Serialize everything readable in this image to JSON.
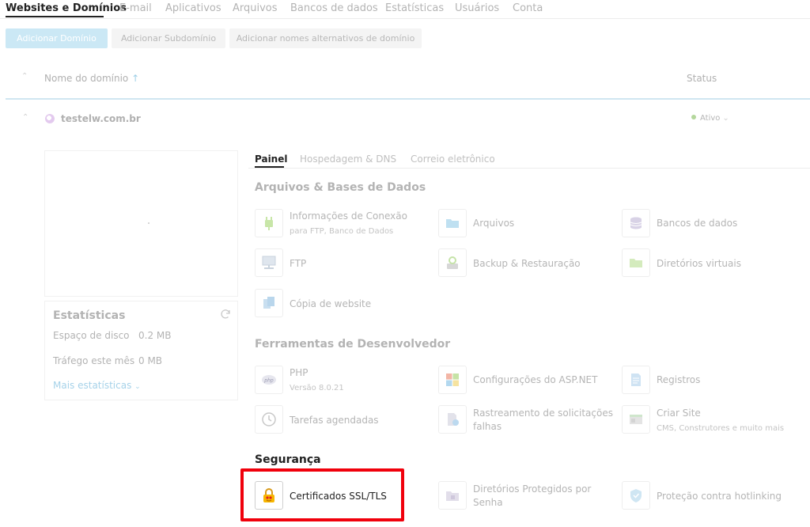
{
  "nav": {
    "tabs": [
      "Websites e Domínios",
      "E-mail",
      "Aplicativos",
      "Arquivos",
      "Bancos de dados",
      "Estatísticas",
      "Usuários",
      "Conta"
    ]
  },
  "toolbar": {
    "add_domain": "Adicionar Domínio",
    "add_subdomain": "Adicionar Subdomínio",
    "add_alias": "Adicionar nomes alternativos de domínio"
  },
  "list_header": {
    "name": "Nome do domínio",
    "sort_arrow": "↑",
    "status": "Status"
  },
  "domain": {
    "name": "testelw.com.br",
    "status": "Ativo"
  },
  "stats": {
    "title": "Estatísticas",
    "disk_label": "Espaço de disco",
    "disk_value": "0.2 MB",
    "traffic_label": "Tráfego este mês",
    "traffic_value": "0 MB",
    "more": "Mais estatísticas"
  },
  "panel_tabs": [
    "Painel",
    "Hospedagem & DNS",
    "Correio eletrônico"
  ],
  "sections": {
    "files_db": {
      "title": "Arquivos & Bases de Dados",
      "items": {
        "connection_info": {
          "title": "Informações de Conexão",
          "sub": "para FTP, Banco de Dados"
        },
        "files": {
          "title": "Arquivos"
        },
        "databases": {
          "title": "Bancos de dados"
        },
        "ftp": {
          "title": "FTP"
        },
        "backup": {
          "title": "Backup & Restauração"
        },
        "virtual_dirs": {
          "title": "Diretórios virtuais"
        },
        "site_copy": {
          "title": "Cópia de website"
        }
      }
    },
    "dev_tools": {
      "title": "Ferramentas de Desenvolvedor",
      "items": {
        "php": {
          "title": "PHP",
          "sub": "Versão 8.0.21",
          "icon_text": "php"
        },
        "aspnet": {
          "title": "Configurações do ASP.NET"
        },
        "logs": {
          "title": "Registros"
        },
        "scheduled": {
          "title": "Tarefas agendadas"
        },
        "failed_req": {
          "title": "Rastreamento de solicitações falhas"
        },
        "create_site": {
          "title": "Criar Site",
          "sub": "CMS, Construtores e muito mais"
        }
      }
    },
    "security": {
      "title": "Segurança",
      "items": {
        "ssl": {
          "title": "Certificados SSL/TLS"
        },
        "protected_dirs": {
          "title": "Diretórios Protegidos por Senha"
        },
        "hotlink": {
          "title": "Proteção contra hotlinking"
        }
      }
    }
  },
  "colors": {
    "highlight": "#f0000c",
    "accent": "#cbe8f5",
    "status_ok": "#b4d79c"
  }
}
